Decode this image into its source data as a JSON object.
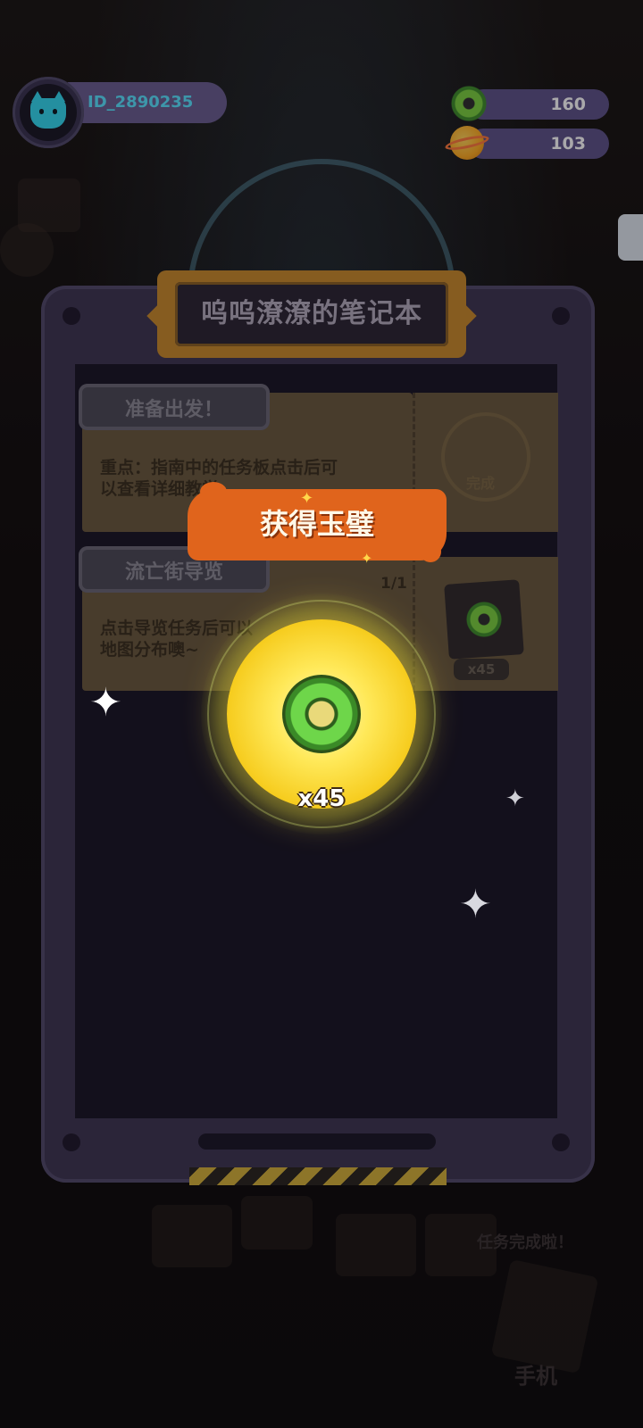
{
  "player": {
    "id_text": "ID_2890235"
  },
  "currencies": [
    {
      "icon": "jade-disc-icon",
      "value": "160"
    },
    {
      "icon": "orange-planet-icon",
      "value": "103"
    }
  ],
  "notebook": {
    "title": "呜呜潦潦的笔记本",
    "quests": [
      {
        "title": "准备出发！",
        "description_line1": "重点：指南中的任务板点击后可",
        "description_line2": "以查看详细教学",
        "stamp_text": "完成"
      },
      {
        "title": "流亡街导览",
        "description_line1": "点击导览任务后可以",
        "description_line2": "地图分布噢~",
        "progress": "1/1",
        "reward_count": "x45"
      }
    ]
  },
  "reward_popup": {
    "banner_text": "获得玉璧",
    "item_icon": "jade-disc-icon",
    "quantity": "x45"
  },
  "background": {
    "task_done_text": "任务完成啦！",
    "phone_label": "手机"
  },
  "colors": {
    "banner": "#e0641c",
    "glow": "#ffe95a",
    "panel": "#3e3652",
    "id_text": "#59e3ff"
  }
}
